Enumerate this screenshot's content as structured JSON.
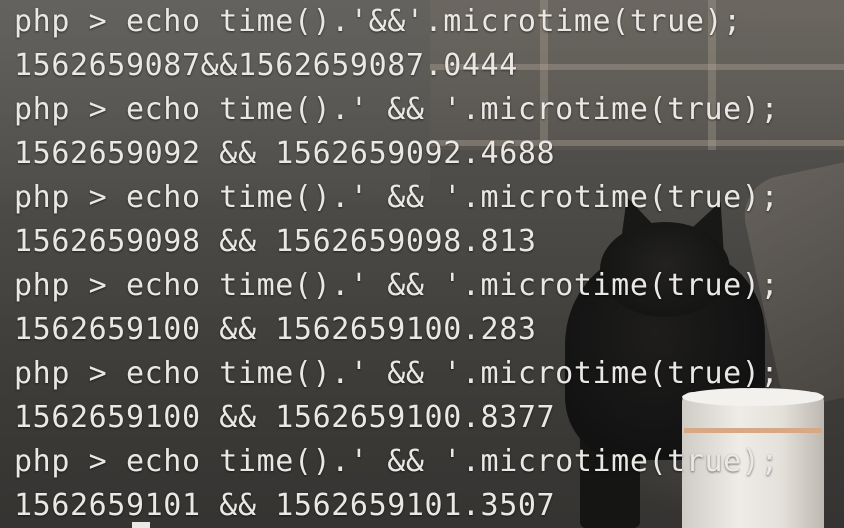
{
  "terminal": {
    "lines": [
      "php > echo time().'&&'.microtime(true);",
      "1562659087&&1562659087.0444",
      "php > echo time().' && '.microtime(true);",
      "1562659092 && 1562659092.4688",
      "php > echo time().' && '.microtime(true);",
      "1562659098 && 1562659098.813",
      "php > echo time().' && '.microtime(true);",
      "1562659100 && 1562659100.283",
      "php > echo time().' && '.microtime(true);",
      "1562659100 && 1562659100.8377",
      "php > echo time().' && '.microtime(true);",
      "1562659101 && 1562659101.3507"
    ]
  },
  "colors": {
    "text": "#eae8e5",
    "background": "#4a4845"
  }
}
